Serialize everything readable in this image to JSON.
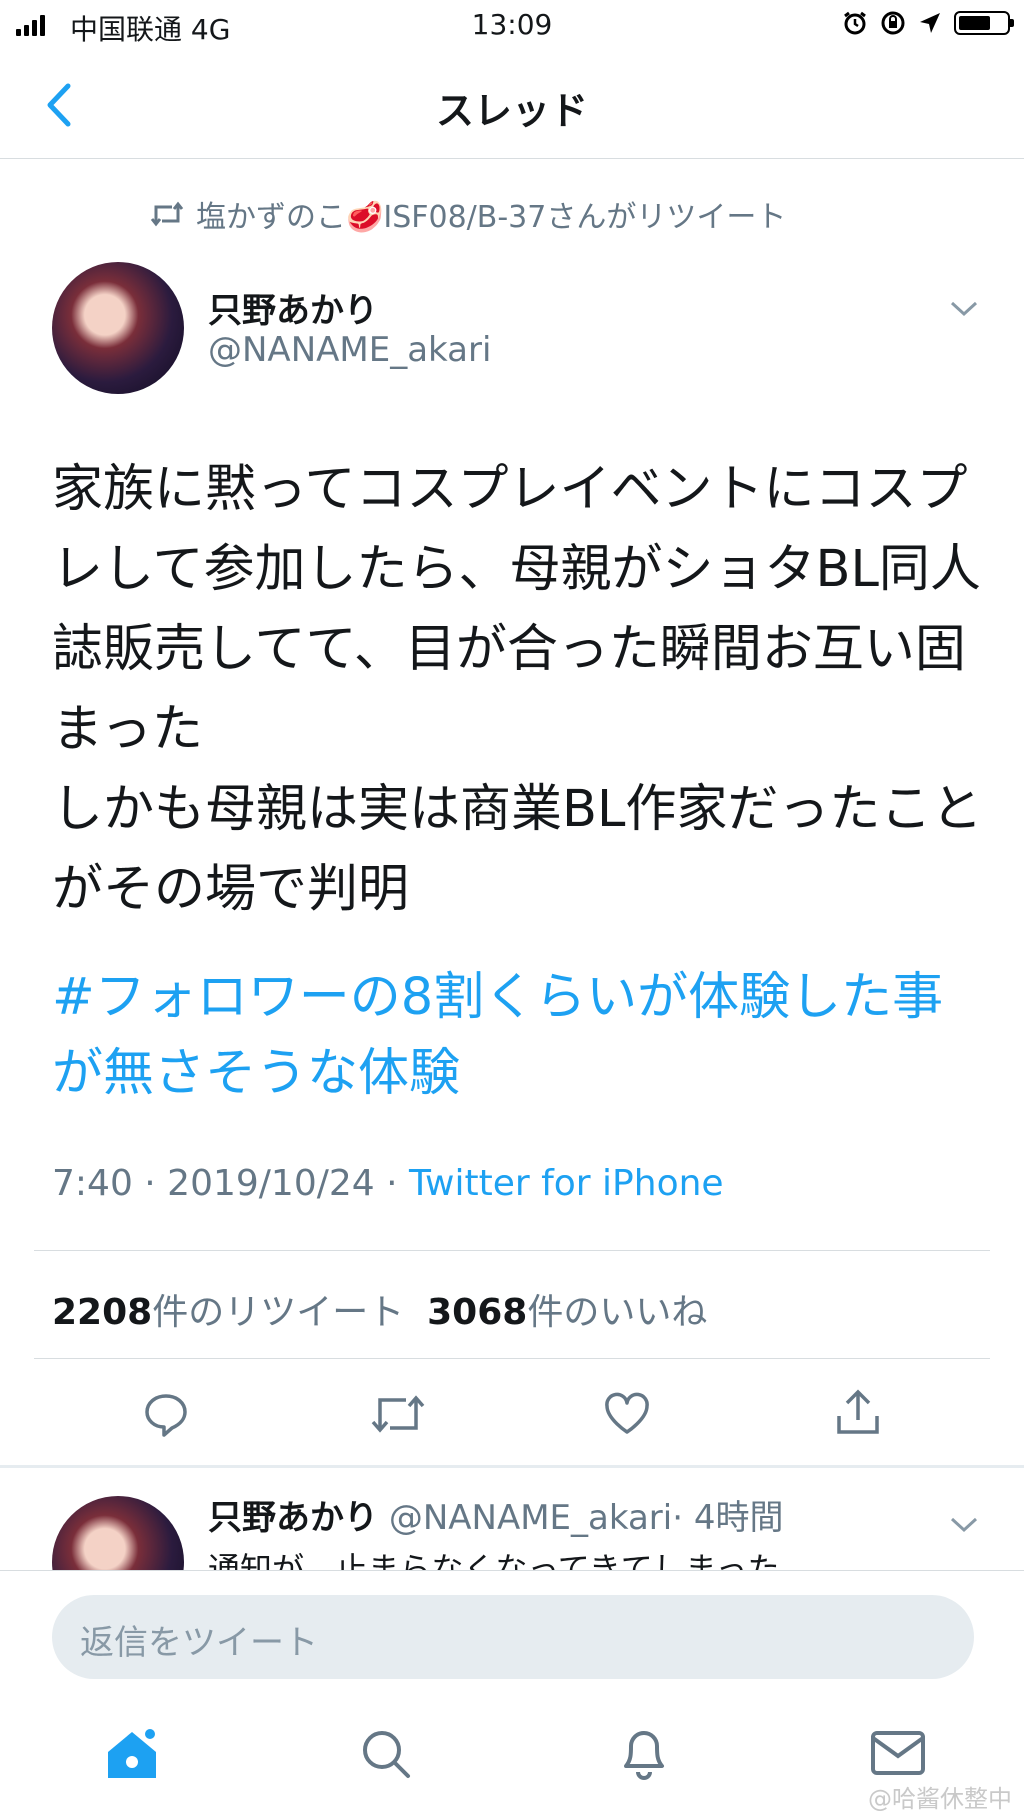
{
  "status_bar": {
    "carrier": "中国联通 4G",
    "time": "13:09"
  },
  "nav": {
    "title": "スレッド"
  },
  "retweet": {
    "text": "塩かずのこ🥩ISF08/B-37さんがリツイート"
  },
  "tweet": {
    "name": "只野あかり",
    "handle": "@NANAME_akari",
    "text": "家族に黙ってコスプレイベントにコスプレして参加したら、母親がショタBL同人誌販売してて、目が合った瞬間お互い固まった\nしかも母親は実は商業BL作家だったことがその場で判明",
    "hashtag": "#フォロワーの8割くらいが体験した事が無さそうな体験",
    "time": "7:40 · 2019/10/24 · ",
    "source": "Twitter for iPhone",
    "retweets_count": "2208",
    "retweets_label": "件のリツイート",
    "likes_count": "3068",
    "likes_label": "件のいいね"
  },
  "reply": {
    "name": "只野あかり",
    "handle": "@NANAME_akari",
    "age": "· 4時間",
    "text": "通知が、止まらなくなってきてしまった"
  },
  "composer": {
    "placeholder": "返信をツイート"
  },
  "watermark": "@哈酱休整中",
  "colors": {
    "accent": "#1da1f2",
    "muted": "#657786",
    "divider": "#d8dde0"
  }
}
